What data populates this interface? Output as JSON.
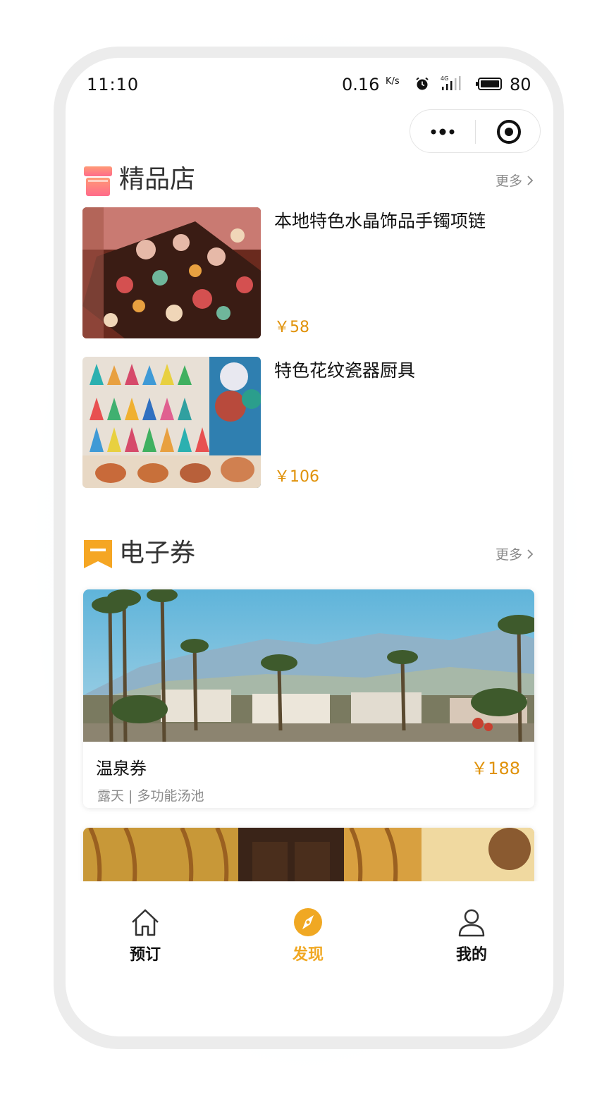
{
  "status_bar": {
    "time": "11:10",
    "net_speed": "0.16",
    "net_unit": "K/s",
    "network": "4G",
    "battery": "80",
    "icons": [
      "alarm-icon",
      "signal-icon",
      "battery-icon"
    ]
  },
  "capsule": {
    "icons": [
      "more-dots-icon",
      "target-icon"
    ]
  },
  "boutique": {
    "title": "精品店",
    "more": "更多",
    "icon": "shop-icon",
    "icon_colors": [
      "#ff9a76",
      "#ff6b8a"
    ],
    "products": [
      {
        "name": "本地特色水晶饰品手镯项链",
        "price": "￥58"
      },
      {
        "name": "特色花纹瓷器厨具",
        "price": "￥106"
      }
    ]
  },
  "coupons": {
    "title": "电子券",
    "more": "更多",
    "icon": "ticket-icon",
    "icon_color": "#f5a623",
    "items": [
      {
        "name": "温泉券",
        "price": "￥188",
        "tags": "露天 | 多功能汤池"
      },
      {
        "name": "",
        "price": "",
        "tags": ""
      }
    ]
  },
  "tab_bar": {
    "accent": "#f0a823",
    "tabs": [
      {
        "label": "预订",
        "icon": "home-icon",
        "active": false
      },
      {
        "label": "发现",
        "icon": "compass-icon",
        "active": true
      },
      {
        "label": "我的",
        "icon": "person-icon",
        "active": false
      }
    ]
  }
}
